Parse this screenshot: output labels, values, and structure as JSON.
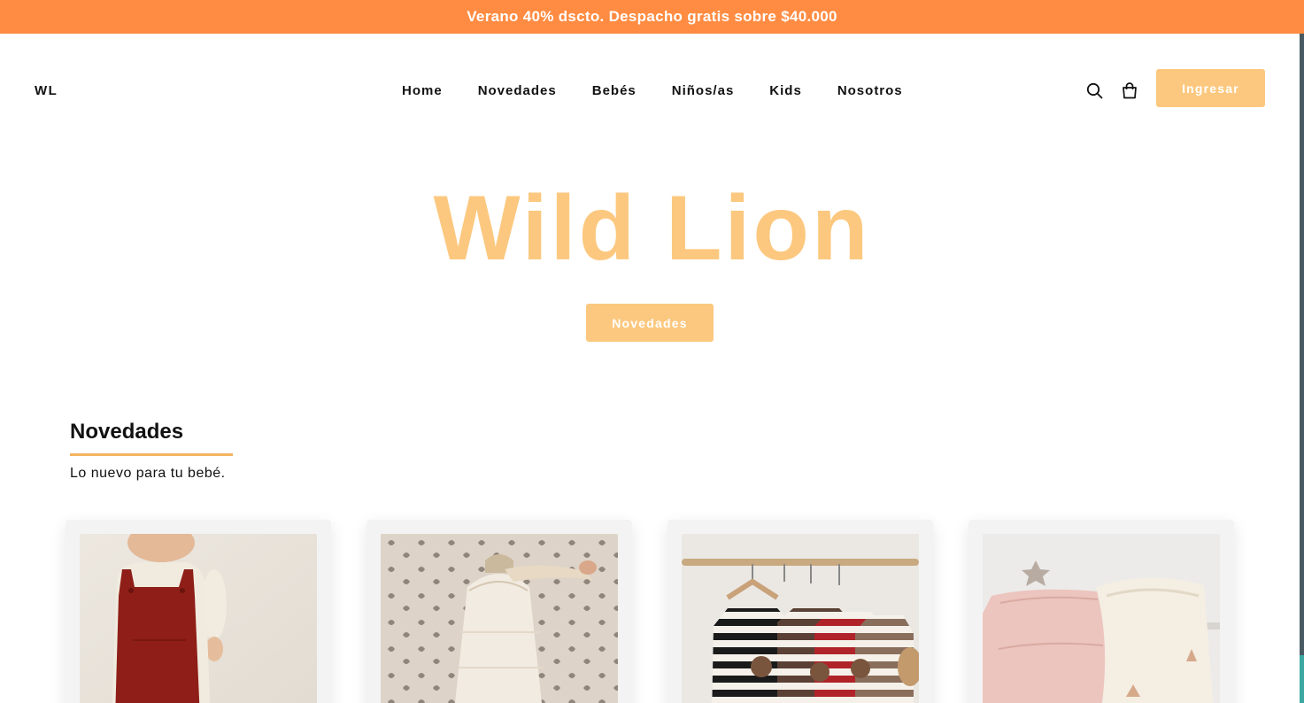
{
  "promo": {
    "text": "Verano 40% dscto. Despacho gratis sobre $40.000"
  },
  "header": {
    "logo": "WL",
    "nav": [
      "Home",
      "Novedades",
      "Bebés",
      "Niños/as",
      "Kids",
      "Nosotros"
    ],
    "icons": {
      "search": "search-icon",
      "cart": "shopping-bag-icon"
    },
    "login_label": "Ingresar"
  },
  "hero": {
    "title": "Wild Lion",
    "button_label": "Novedades"
  },
  "section": {
    "title": "Novedades",
    "subtitle": "Lo nuevo para tu bebé."
  },
  "products": [
    {
      "image": "red-knit-overall-photo"
    },
    {
      "image": "muslin-sleep-sack-photo"
    },
    {
      "image": "striped-rompers-on-hangers-photo"
    },
    {
      "image": "pink-muslin-blanket-photo"
    }
  ],
  "colors": {
    "promo": "#ff8c42",
    "accent": "#fcc87f",
    "underline": "#f5b463"
  }
}
